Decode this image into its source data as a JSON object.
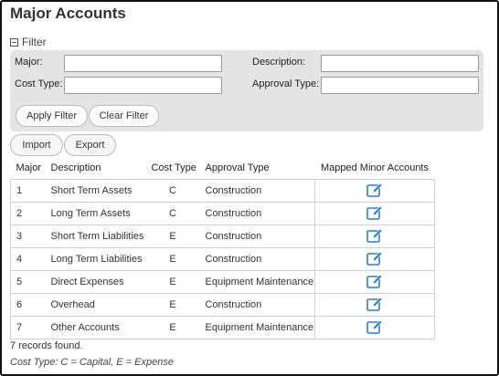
{
  "page": {
    "title": "Major Accounts"
  },
  "filter": {
    "toggle_label": "Filter",
    "fields": {
      "major_label": "Major:",
      "major_value": "",
      "description_label": "Description:",
      "description_value": "",
      "cost_type_label": "Cost Type:",
      "cost_type_value": "",
      "approval_type_label": "Approval Type:",
      "approval_type_value": ""
    },
    "apply_label": "Apply Filter",
    "clear_label": "Clear Filter"
  },
  "actions": {
    "import_label": "Import",
    "export_label": "Export"
  },
  "table": {
    "columns": [
      "Major",
      "Description",
      "Cost Type",
      "Approval Type",
      "Mapped Minor Accounts"
    ],
    "rows": [
      {
        "major": "1",
        "description": "Short Term Assets",
        "cost_type": "C",
        "approval_type": "Construction"
      },
      {
        "major": "2",
        "description": "Long Term Assets",
        "cost_type": "C",
        "approval_type": "Construction"
      },
      {
        "major": "3",
        "description": "Short Term Liabilities",
        "cost_type": "E",
        "approval_type": "Construction"
      },
      {
        "major": "4",
        "description": "Long Term Liabilities",
        "cost_type": "E",
        "approval_type": "Construction"
      },
      {
        "major": "5",
        "description": "Direct Expenses",
        "cost_type": "E",
        "approval_type": "Equipment Maintenance"
      },
      {
        "major": "6",
        "description": "Overhead",
        "cost_type": "E",
        "approval_type": "Construction"
      },
      {
        "major": "7",
        "description": "Other Accounts",
        "cost_type": "E",
        "approval_type": "Equipment Maintenance"
      }
    ],
    "row_action_icon": "edit-icon"
  },
  "footer": {
    "records_text": "7 records found.",
    "legend_text": "Cost Type: C = Capital, E = Expense"
  },
  "colors": {
    "accent": "#2a7fd4",
    "panel_bg": "#e4e4e4",
    "border": "#d0d0d0"
  }
}
